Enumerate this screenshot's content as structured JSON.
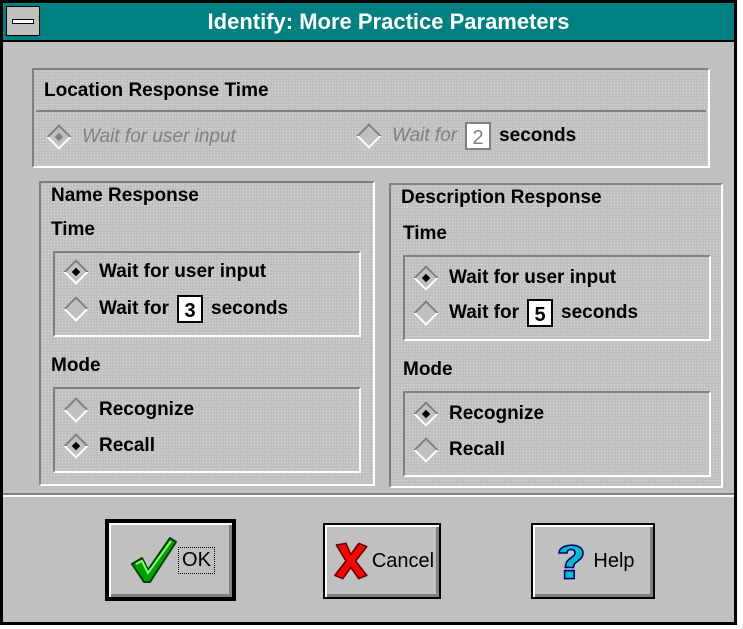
{
  "window": {
    "title": "Identify: More Practice Parameters"
  },
  "location": {
    "heading": "Location Response Time",
    "opt_wait_input": "Wait for user input",
    "opt_wait_for": "Wait for",
    "seconds_value": "2",
    "seconds_label": "seconds",
    "selected": "wait_input",
    "enabled": false
  },
  "name_response": {
    "heading": "Name Response",
    "time_heading": "Time",
    "opt_wait_input": "Wait for user input",
    "opt_wait_for": "Wait for",
    "seconds_value": "3",
    "seconds_label": "seconds",
    "time_selected": "wait_input",
    "mode_heading": "Mode",
    "opt_recognize": "Recognize",
    "opt_recall": "Recall",
    "mode_selected": "recall"
  },
  "description_response": {
    "heading": "Description Response",
    "time_heading": "Time",
    "opt_wait_input": "Wait for user input",
    "opt_wait_for": "Wait for",
    "seconds_value": "5",
    "seconds_label": "seconds",
    "time_selected": "wait_input",
    "mode_heading": "Mode",
    "opt_recognize": "Recognize",
    "opt_recall": "Recall",
    "mode_selected": "recognize"
  },
  "buttons": {
    "ok": "OK",
    "cancel": "Cancel",
    "help": "Help"
  },
  "colors": {
    "title_bar": "#008080",
    "face": "#c0c0c0",
    "ok_check": "#00a000",
    "cancel_x": "#ff0000",
    "help_mark": "#00c0c0"
  }
}
